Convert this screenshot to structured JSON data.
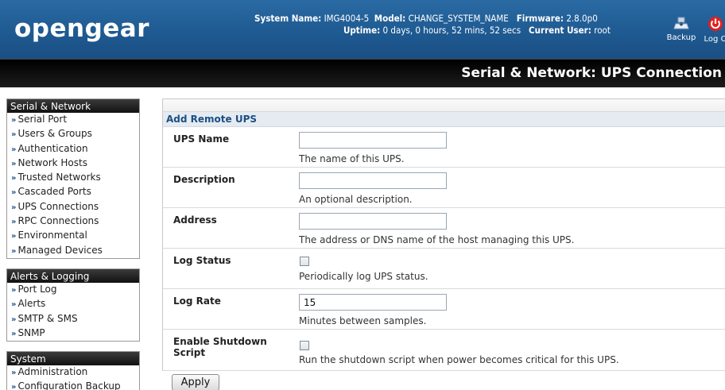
{
  "header": {
    "logo": "opengear",
    "system_name_label": "System Name:",
    "system_name": "IMG4004-5",
    "model_label": "Model:",
    "model": "CHANGE_SYSTEM_NAME",
    "firmware_label": "Firmware:",
    "firmware": "2.8.0p0",
    "uptime_label": "Uptime:",
    "uptime": "0 days, 0 hours, 52 mins, 52 secs",
    "current_user_label": "Current User:",
    "current_user": "root",
    "backup_label": "Backup",
    "logout_label": "Log O"
  },
  "page_title": "Serial & Network: UPS Connection",
  "sidebar": {
    "groups": [
      {
        "title": "Serial & Network",
        "items": [
          "Serial Port",
          "Users & Groups",
          "Authentication",
          "Network Hosts",
          "Trusted Networks",
          "Cascaded Ports",
          "UPS Connections",
          "RPC Connections",
          "Environmental",
          "Managed Devices"
        ]
      },
      {
        "title": "Alerts & Logging",
        "items": [
          "Port Log",
          "Alerts",
          "SMTP & SMS",
          "SNMP"
        ]
      },
      {
        "title": "System",
        "items": [
          "Administration",
          "Configuration Backup"
        ]
      }
    ]
  },
  "form": {
    "section_title": "Add Remote UPS",
    "fields": [
      {
        "label": "UPS Name",
        "type": "text",
        "value": "",
        "help": "The name of this UPS."
      },
      {
        "label": "Description",
        "type": "text",
        "value": "",
        "help": "An optional description."
      },
      {
        "label": "Address",
        "type": "text",
        "value": "",
        "help": "The address or DNS name of the host managing this UPS."
      },
      {
        "label": "Log Status",
        "type": "checkbox",
        "checked": false,
        "help": "Periodically log UPS status."
      },
      {
        "label": "Log Rate",
        "type": "text",
        "value": "15",
        "help": "Minutes between samples."
      },
      {
        "label": "Enable Shutdown Script",
        "type": "checkbox",
        "checked": false,
        "help": "Run the shutdown script when power becomes critical for this UPS."
      }
    ],
    "apply_label": "Apply"
  },
  "colors": {
    "header_blue": "#1f5a92",
    "accent": "#1a4f83",
    "logout_red": "#e02020"
  },
  "icons": {
    "backup": "backup-drive-icon",
    "logout": "power-icon"
  }
}
